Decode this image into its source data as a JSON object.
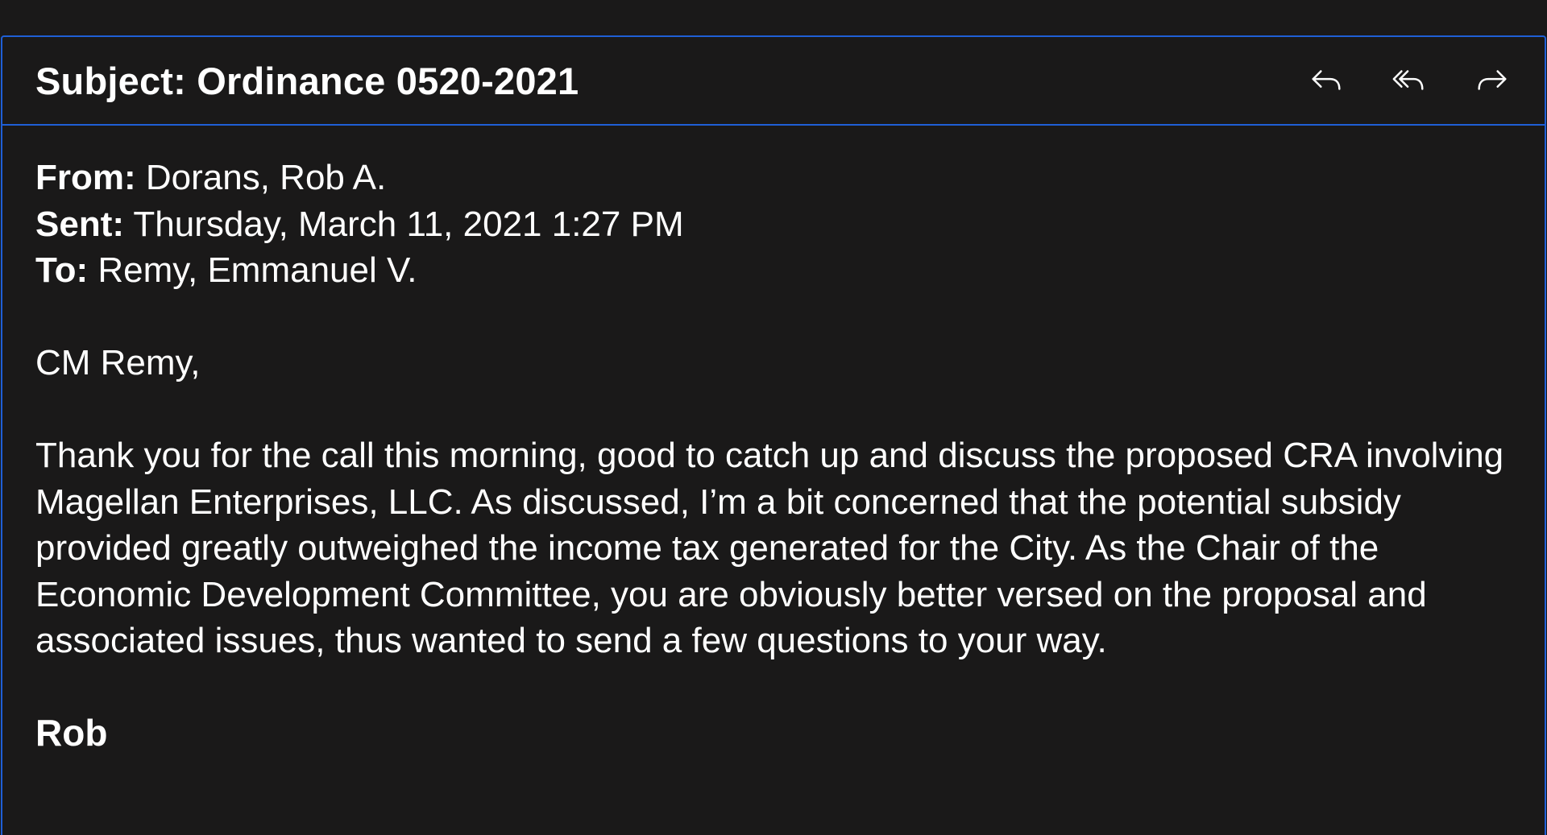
{
  "email": {
    "subject": "Subject: Ordinance 0520-2021",
    "actions": {
      "reply_icon": "reply-icon",
      "reply_all_icon": "reply-all-icon",
      "forward_icon": "forward-icon"
    },
    "from_label": "From:",
    "from_value": " Dorans, Rob A.",
    "sent_label": "Sent:",
    "sent_value": " Thursday, March 11, 2021 1:27 PM",
    "to_label": "To:",
    "to_value": " Remy, Emmanuel V.",
    "greeting": "CM Remy,",
    "body": "Thank you for the call this morning, good to catch up and discuss the proposed CRA involving Magellan Enterprises, LLC. As discussed, I’m a bit concerned that the potential subsidy provided greatly outweighed the income tax generated for the City. As the Chair of the Economic Development Committee, you are obviously better versed on the proposal and associated issues, thus wanted to send a few questions to your way.",
    "signature": "Rob"
  },
  "colors": {
    "background": "#1a1919",
    "border_accent": "#1f5fd6",
    "text": "#ffffff"
  }
}
